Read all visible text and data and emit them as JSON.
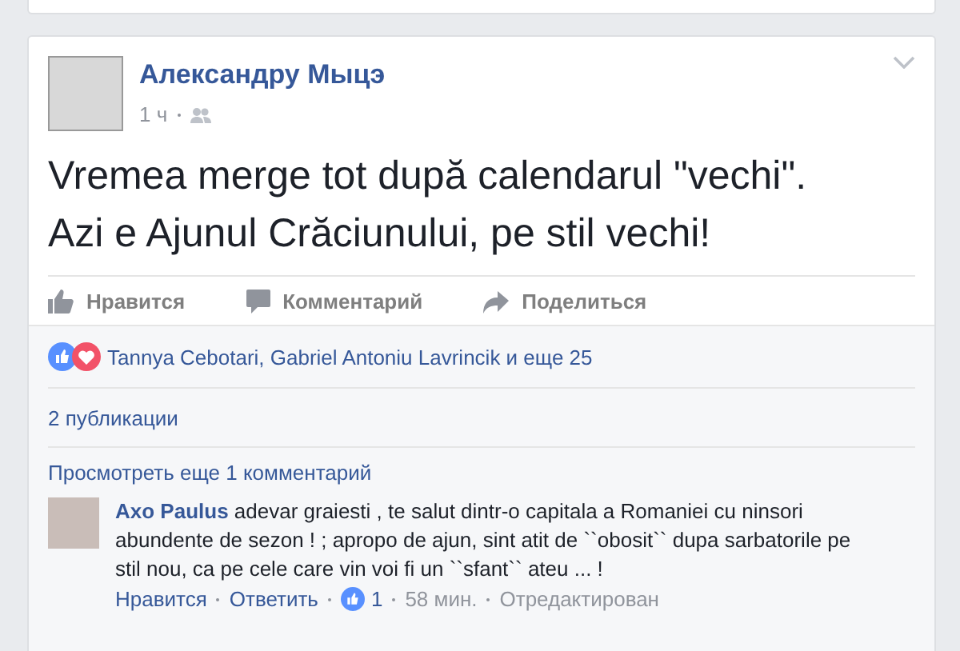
{
  "post": {
    "author": "Александру Мыцэ",
    "time": "1 ч",
    "text": [
      "Vremea merge tot după calendarul \"vechi\".",
      "Azi e Ajunul Crăciunului, pe stil vechi!"
    ],
    "actions": [
      {
        "kind": "like",
        "label": "Нравится"
      },
      {
        "kind": "comment",
        "label": "Комментарий"
      },
      {
        "kind": "share",
        "label": "Поделиться"
      }
    ],
    "reactions": {
      "summary": "Tannya Cebotari, Gabriel Antoniu Lavrincik и еще 25"
    },
    "shares": "2 публикации",
    "more_comments": "Просмотреть еще 1 комментарий",
    "comments": [
      {
        "author": "Axo Paulus",
        "text": "adevar graiesti , te salut dintr-o capitala a Romaniei cu ninsori abundente de sezon ! ; apropo de ajun, sint atit de ``obosit`` dupa sarbatorile pe stil nou, ca pe cele care vin voi fi un ``sfant`` ateu ... !",
        "like": "Нравится",
        "reply": "Ответить",
        "likes": "1",
        "time": "58 мин.",
        "edited": "Отредактирован"
      }
    ]
  }
}
